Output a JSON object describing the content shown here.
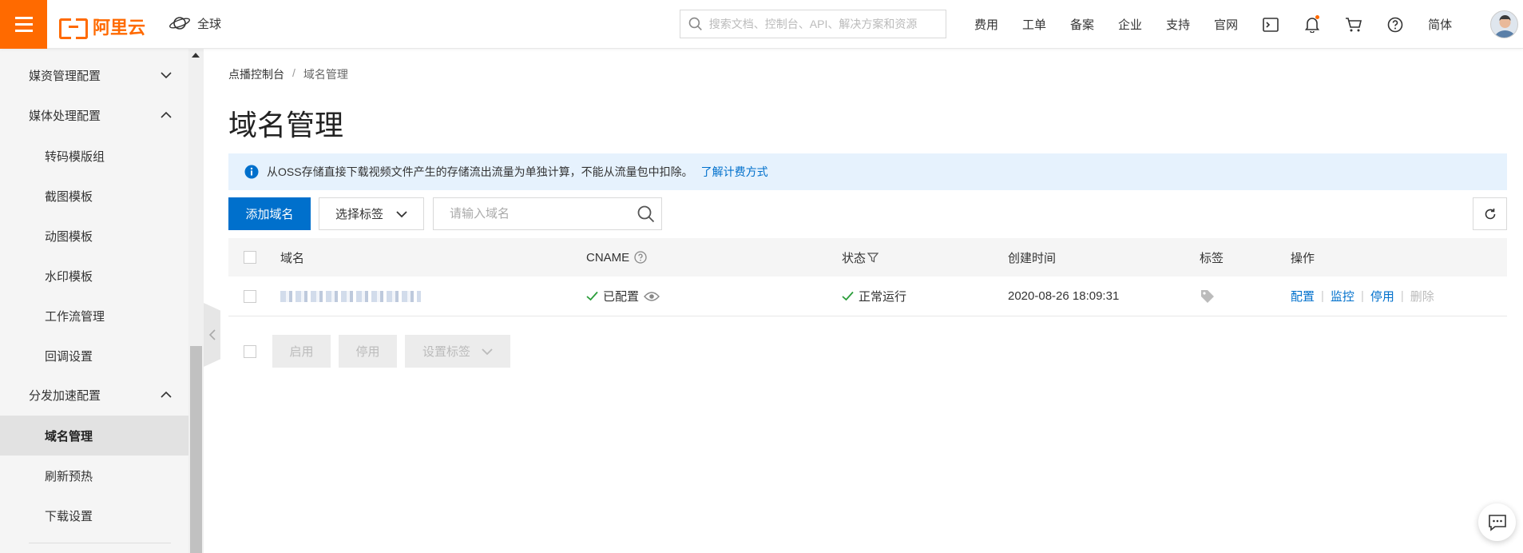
{
  "header": {
    "logo_text": "阿里云",
    "region_label": "全球",
    "search_placeholder": "搜索文档、控制台、API、解决方案和资源",
    "nav": [
      "费用",
      "工单",
      "备案",
      "企业",
      "支持",
      "官网"
    ],
    "lang": "简体",
    "accent_color": "#ff6a00"
  },
  "sidebar": {
    "groups": [
      {
        "label": "媒资管理配置",
        "state": "collapsed"
      },
      {
        "label": "媒体处理配置",
        "state": "expanded"
      },
      {
        "label": "分发加速配置",
        "state": "expanded"
      }
    ],
    "media_items": [
      "转码模版组",
      "截图模板",
      "动图模板",
      "水印模板",
      "工作流管理",
      "回调设置"
    ],
    "dist_items": [
      "域名管理",
      "刷新预热",
      "下载设置"
    ],
    "active": "域名管理"
  },
  "breadcrumb": {
    "parent": "点播控制台",
    "sep": "/",
    "current": "域名管理"
  },
  "page_title": "域名管理",
  "notice": {
    "text": "从OSS存储直接下载视频文件产生的存储流出流量为单独计算，不能从流量包中扣除。",
    "link": "了解计费方式"
  },
  "toolbar": {
    "add_label": "添加域名",
    "tag_select_label": "选择标签",
    "search_placeholder": "请输入域名",
    "primary_color": "#0070cc"
  },
  "table": {
    "headers": {
      "domain": "域名",
      "cname": "CNAME",
      "status": "状态",
      "created": "创建时间",
      "tag": "标签",
      "ops": "操作"
    },
    "rows": [
      {
        "cname_status": "已配置",
        "status": "正常运行",
        "created": "2020-08-26 18:09:31",
        "ops": {
          "config": "配置",
          "monitor": "监控",
          "disable": "停用",
          "delete": "删除"
        }
      }
    ]
  },
  "batch": {
    "enable": "启用",
    "disable": "停用",
    "set_tag": "设置标签"
  }
}
